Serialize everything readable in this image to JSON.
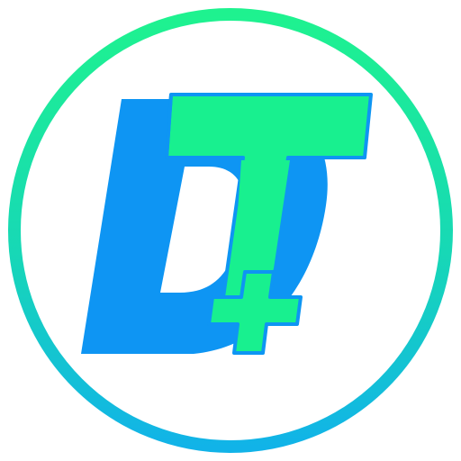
{
  "logo": {
    "monogram": "DT+",
    "icon": "dt-plus-logo-icon",
    "colors": {
      "ring_top": "#1ef28f",
      "ring_bottom": "#11b3e8",
      "letter_d": "#0e95f3",
      "letter_t": "#18f08f",
      "plus": "#18f08f",
      "outline": "#0e95f3",
      "background": "#ffffff"
    }
  }
}
